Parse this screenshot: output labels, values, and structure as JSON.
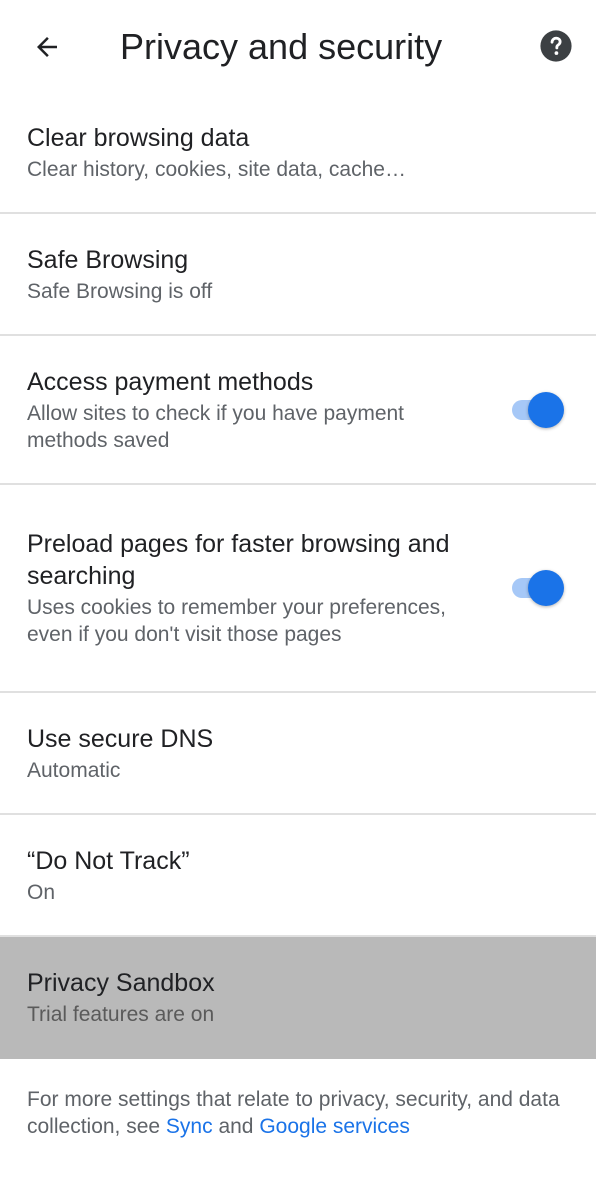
{
  "header": {
    "title": "Privacy and security",
    "back_icon": "arrow-back-icon",
    "help_icon": "help-circle-icon"
  },
  "items": [
    {
      "title": "Clear browsing data",
      "subtitle": "Clear history, cookies, site data, cache…"
    },
    {
      "title": "Safe Browsing",
      "subtitle": "Safe Browsing is off"
    },
    {
      "title": "Access payment methods",
      "subtitle": "Allow sites to check if you have payment methods saved",
      "toggle": true
    },
    {
      "title": "Preload pages for faster browsing and searching",
      "subtitle": "Uses cookies to remember your preferences, even if you don't visit those pages",
      "toggle": true
    },
    {
      "title": "Use secure DNS",
      "subtitle": "Automatic"
    },
    {
      "title": "“Do Not Track”",
      "subtitle": "On"
    },
    {
      "title": "Privacy Sandbox",
      "subtitle": "Trial features are on",
      "selected": true
    }
  ],
  "footer": {
    "text_before": "For more settings that relate to privacy, security, and data collection, see ",
    "link_sync": "Sync",
    "text_between": " and ",
    "link_google_services": "Google services"
  },
  "colors": {
    "accent": "#1a73e8",
    "switch_track": "#a6c8f7",
    "selected_row": "#b9b9b9",
    "divider": "#e0e0e0"
  }
}
